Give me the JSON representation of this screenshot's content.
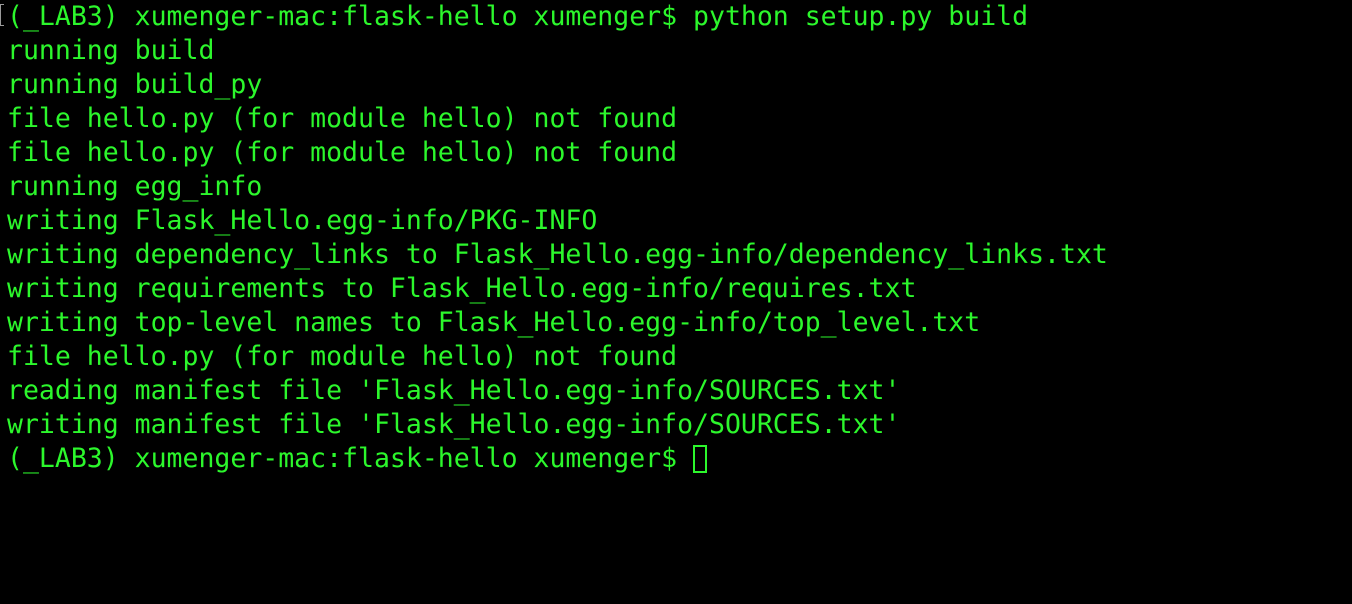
{
  "terminal": {
    "text_color": "#2cf72c",
    "background_color": "#000000",
    "lines": [
      "(_LAB3) xumenger-mac:flask-hello xumenger$ python setup.py build",
      "running build",
      "running build_py",
      "file hello.py (for module hello) not found",
      "file hello.py (for module hello) not found",
      "running egg_info",
      "writing Flask_Hello.egg-info/PKG-INFO",
      "writing dependency_links to Flask_Hello.egg-info/dependency_links.txt",
      "writing requirements to Flask_Hello.egg-info/requires.txt",
      "writing top-level names to Flask_Hello.egg-info/top_level.txt",
      "file hello.py (for module hello) not found",
      "reading manifest file 'Flask_Hello.egg-info/SOURCES.txt'",
      "writing manifest file 'Flask_Hello.egg-info/SOURCES.txt'"
    ],
    "prompt": "(_LAB3) xumenger-mac:flask-hello xumenger$ "
  }
}
